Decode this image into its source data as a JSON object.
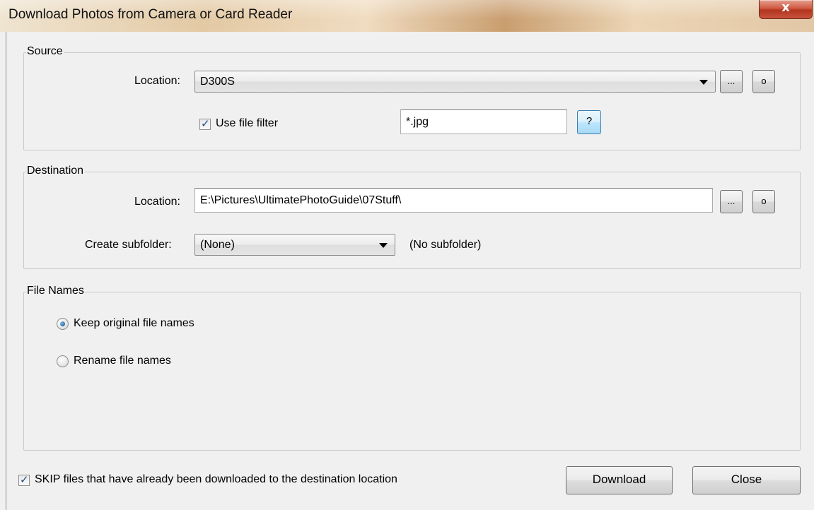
{
  "window": {
    "title": "Download Photos from Camera or Card Reader",
    "close_label": "x"
  },
  "source": {
    "group_title": "Source",
    "location_label": "Location:",
    "location_value": "D300S",
    "browse_label": "...",
    "open_label": "o",
    "use_filter_label": "Use file filter",
    "use_filter_checked": true,
    "filter_value": "*.jpg",
    "help_label": "?"
  },
  "destination": {
    "group_title": "Destination",
    "location_label": "Location:",
    "location_value": "E:\\Pictures\\UltimatePhotoGuide\\07Stuff\\",
    "browse_label": "...",
    "open_label": "o",
    "subfolder_label": "Create subfolder:",
    "subfolder_value": "(None)",
    "subfolder_hint": "(No subfolder)"
  },
  "file_names": {
    "group_title": "File Names",
    "options": [
      {
        "label": "Keep original file names",
        "selected": true
      },
      {
        "label": "Rename file names",
        "selected": false
      }
    ]
  },
  "footer": {
    "skip_label": "SKIP files that have already been downloaded to the destination location",
    "skip_checked": true,
    "download_label": "Download",
    "close_label": "Close"
  }
}
